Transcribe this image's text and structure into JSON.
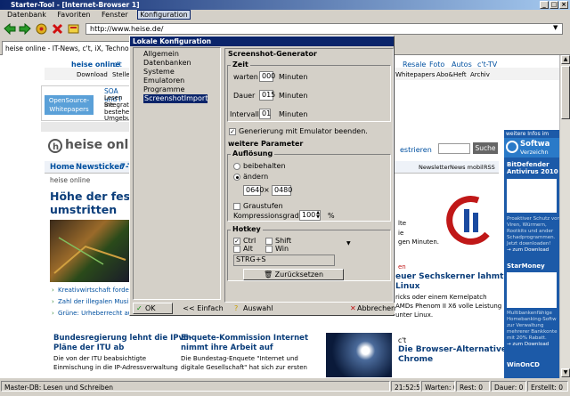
{
  "window": {
    "title": "Starter-Tool - [Internet-Browser 1]"
  },
  "menu": {
    "items": [
      "Datenbank",
      "Favoriten",
      "Fenster",
      "Konfiguration"
    ]
  },
  "address": {
    "url": "http://www.heise.de/"
  },
  "tab": {
    "label": "heise online - IT-News, c't, iX, Technology R"
  },
  "web": {
    "logo": "heise online",
    "nav_top": [
      "c't",
      "Resale",
      "Foto",
      "Autos",
      "c't-TV"
    ],
    "nav_second": [
      "Download",
      "Stelle",
      "Whitepapers",
      "Abo&Heft",
      "Archiv"
    ],
    "banner": {
      "title": "SOA und I",
      "line1": "Lesen Sie",
      "line2": "Integration",
      "line3": "bestehen",
      "line4": "Umgebung",
      "badge": "OpenSource-Whitepapers"
    },
    "logo2": "heise onlin",
    "search_btn": "Suche",
    "search_link": "estrieren",
    "nav_main": [
      "Home",
      "Newsticker",
      "7-Ta"
    ],
    "nav_right": [
      "Newsletter",
      "News mobil",
      "RSS"
    ],
    "breadcrumb": "heise online",
    "headline": "Höhe der festgele",
    "headline2": "umstritten",
    "bullets": [
      "Kreativwirtschaft fordert be",
      "Zahl der illegalen Musikdo",
      "Grüne: Urheberrecht auf h"
    ],
    "mid_text": [
      "lte",
      "ie",
      "gen Minuten."
    ],
    "art2_title": [
      "euer Sechskerner lahmt",
      "Linux"
    ],
    "art2_text": [
      "ricks oder einem Kernelpatch",
      "AMDs Phenom II X6 volle Leistung",
      "unter Linux."
    ],
    "art2_kicker": "en",
    "bottom_left_title": [
      "Bundesregierung lehnt die IPv6-",
      "Pläne der ITU ab"
    ],
    "bottom_left_text": [
      "Die von der ITU beabsichtigte",
      "Einmischung in die IP-Adressverwaltung"
    ],
    "bottom_mid_title": [
      "Enquete-Kommission Internet",
      "nimmt ihre Arbeit auf"
    ],
    "bottom_mid_text": [
      "Die Bundestag-Enquete \"Internet und",
      "digitale Gesellschaft\" hat sich zur ersten"
    ],
    "ct_kicker": "c't",
    "ct_title": [
      "Die Browser-Alternative",
      "Chrome"
    ],
    "right_ad": {
      "header": "weitere Infos im",
      "soft": "Softwa",
      "verz": "Verzeichn",
      "p1_title": "BitDefender Antivirus 2010",
      "p1_text": [
        "Proaktiver Schutz vor",
        "Viren, Würmern,",
        "Rootkits und ander",
        "Schadprogrammen.",
        "Jetzt downloaden!",
        "→ zum Download"
      ],
      "p2_title": "StarMoney",
      "p2_text": [
        "Multibankenfähige",
        "Homebanking-Softw",
        "zur Verwaltung",
        "mehrerer Bankkonte",
        "mit 20% Rabatt.",
        "→ zum Download"
      ],
      "p3_title": "WinOnCD"
    }
  },
  "dialog": {
    "title": "Lokale Konfiguration",
    "tree": [
      "Allgemein",
      "Datenbanken",
      "Systeme",
      "Emulatoren",
      "Programme",
      "ScreenshotImport"
    ],
    "section1": "Screenshot-Generator",
    "zeit": {
      "legend": "Zeit",
      "rows": [
        {
          "label": "warten",
          "value": "000",
          "unit": "Minuten"
        },
        {
          "label": "Dauer",
          "value": "015",
          "unit": "Minuten"
        },
        {
          "label": "Intervall",
          "value": "01",
          "unit": "Minuten"
        }
      ]
    },
    "gen_check": "Generierung mit Emulator beenden.",
    "section2": "weitere Parameter",
    "aufl": {
      "legend": "Auflösung",
      "keep": "beibehalten",
      "change": "ändern",
      "w": "0640",
      "x": "×",
      "h": "0480",
      "gray": "Graustufen",
      "comp": "Kompressionsgrad",
      "comp_val": "100",
      "pct": "%"
    },
    "hotkey": {
      "legend": "Hotkey",
      "ctrl": "Ctrl",
      "shift": "Shift",
      "alt": "Alt",
      "win": "Win",
      "value": "STRG+S",
      "reset": "Zurücksetzen"
    },
    "buttons": {
      "ok": "OK",
      "einfach": "<< Einfach",
      "auswahl": "Auswahl",
      "abbrechen": "Abbrechen"
    }
  },
  "status": {
    "main": "Master-DB: Lesen und Schreiben",
    "time": "21:52:55",
    "warten": "Warten: 0",
    "rest": "Rest: 0",
    "dauer": "Dauer: 0",
    "erstellt": "Erstellt: 0"
  }
}
